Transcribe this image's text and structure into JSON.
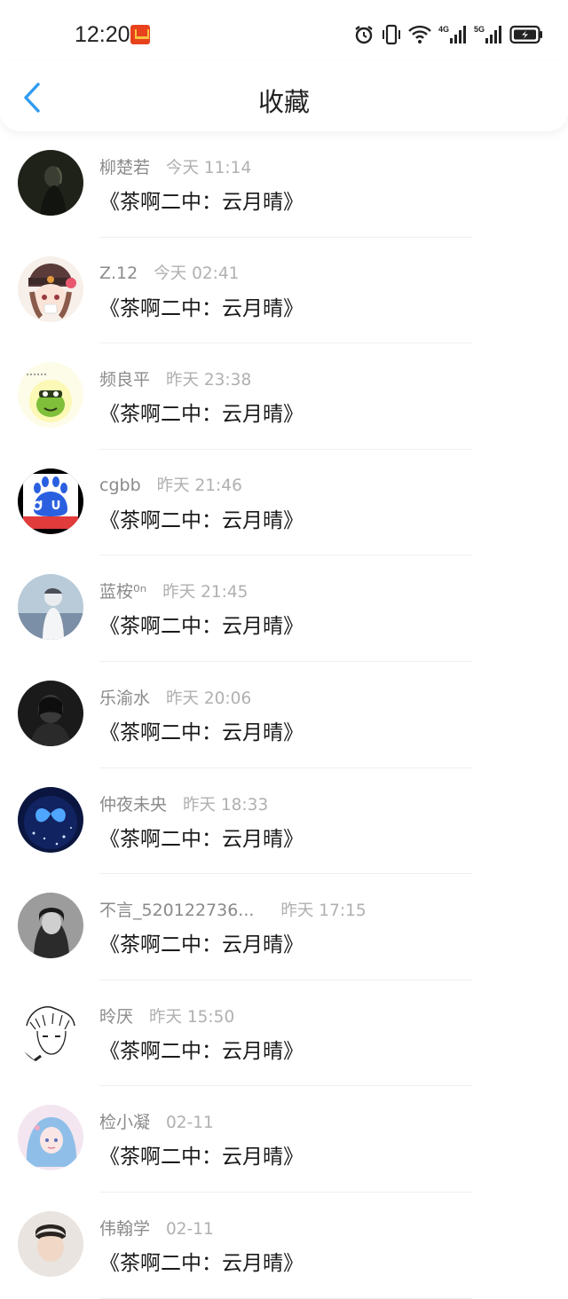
{
  "status_bar": {
    "time": "12:20",
    "net1": "4G",
    "net2": "5G",
    "icons": [
      "app-notification-icon",
      "alarm-icon",
      "vibrate-icon",
      "wifi-icon",
      "signal-4g-icon",
      "signal-5g-icon",
      "battery-icon"
    ]
  },
  "header": {
    "title": "收藏",
    "back_icon": "chevron-left-icon",
    "accent": "#2f9bf0"
  },
  "items": [
    {
      "name": "柳楚若",
      "time": "今天 11:14",
      "title": "《茶啊二中：云月晴》",
      "avatar": "dark-figure"
    },
    {
      "name": "Z.12",
      "time": "今天 02:41",
      "title": "《茶啊二中：云月晴》",
      "avatar": "anime-girl-hat"
    },
    {
      "name": "频良平",
      "time": "昨天 23:38",
      "title": "《茶啊二中：云月晴》",
      "avatar": "green-frog-lets-party"
    },
    {
      "name": "cgbb",
      "time": "昨天 21:46",
      "title": "《茶啊二中：云月晴》",
      "avatar": "baidu-du-logo"
    },
    {
      "name": "蓝桉⁰ⁿ",
      "time": "昨天 21:45",
      "title": "《茶啊二中：云月晴》",
      "avatar": "anime-boy-sky"
    },
    {
      "name": "乐渝水",
      "time": "昨天 20:06",
      "title": "《茶啊二中：云月晴》",
      "avatar": "dark-hooded-figure"
    },
    {
      "name": "仲夜未央",
      "time": "昨天 18:33",
      "title": "《茶啊二中：云月晴》",
      "avatar": "blue-butterfly-night"
    },
    {
      "name": "不言_520122736...",
      "time": "昨天 17:15",
      "title": "《茶啊二中：云月晴》",
      "avatar": "hooded-person-dark"
    },
    {
      "name": "昤厌",
      "time": "昨天 15:50",
      "title": "《茶啊二中：云月晴》",
      "avatar": "manga-boy-sketch"
    },
    {
      "name": "检小凝",
      "time": "02-11",
      "title": "《茶啊二中：云月晴》",
      "avatar": "anime-girl-blue-hair"
    },
    {
      "name": "伟翰学",
      "time": "02-11",
      "title": "《茶啊二中：云月晴》",
      "avatar": "boy-portrait"
    }
  ]
}
